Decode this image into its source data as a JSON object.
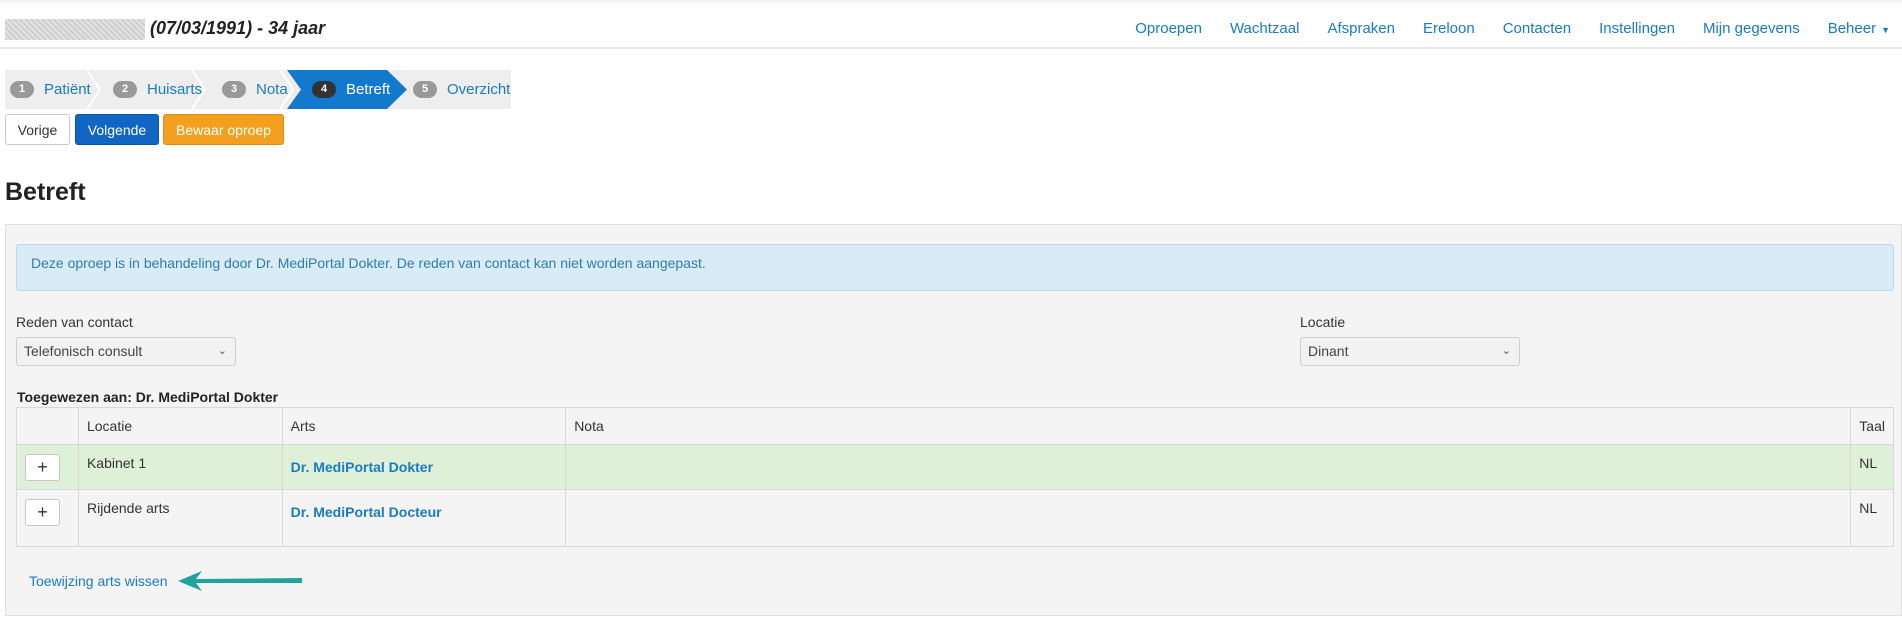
{
  "header": {
    "patient_title": "(07/03/1991) - 34 jaar",
    "nav": [
      "Oproepen",
      "Wachtzaal",
      "Afspraken",
      "Ereloon",
      "Contacten",
      "Instellingen",
      "Mijn gegevens",
      "Beheer"
    ]
  },
  "steps": [
    {
      "num": "1",
      "label": "Patiënt"
    },
    {
      "num": "2",
      "label": "Huisarts"
    },
    {
      "num": "3",
      "label": "Nota"
    },
    {
      "num": "4",
      "label": "Betreft"
    },
    {
      "num": "5",
      "label": "Overzicht"
    }
  ],
  "toolbar": {
    "prev_label": "Vorige",
    "next_label": "Volgende",
    "save_label": "Bewaar oproep"
  },
  "page": {
    "title": "Betreft",
    "alert": "Deze oproep is in behandeling door Dr. MediPortal Dokter. De reden van contact kan niet worden aangepast."
  },
  "form": {
    "reason_label": "Reden van contact",
    "reason_value": "Telefonisch consult",
    "location_label": "Locatie",
    "location_value": "Dinant"
  },
  "assigned_label": "Toegewezen aan: Dr. MediPortal Dokter",
  "table": {
    "headers": [
      "",
      "Locatie",
      "Arts",
      "Nota",
      "Taal"
    ],
    "rows": [
      {
        "location": "Kabinet 1",
        "doctor": "Dr. MediPortal Dokter",
        "note": "",
        "language": "NL"
      },
      {
        "location": "Rijdende arts",
        "doctor": "Dr. MediPortal Docteur",
        "note": "",
        "language": "NL"
      }
    ],
    "add_symbol": "+"
  },
  "clear_link": "Toewijzing arts wissen",
  "colors": {
    "accent": "#1166c4",
    "warning": "#f3a021",
    "link": "#1a7bbf",
    "annotation_arrow": "#1fa39b"
  }
}
